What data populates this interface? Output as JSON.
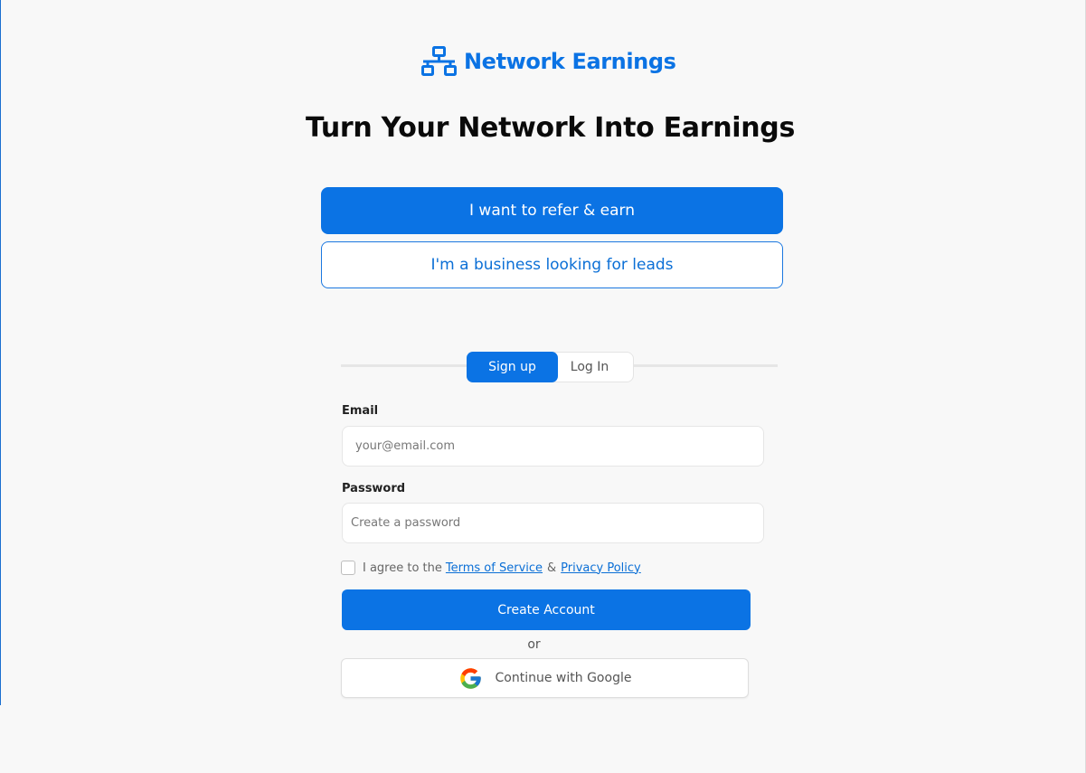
{
  "brand": {
    "name": "Network Earnings",
    "color": "#0b73e4"
  },
  "hero": {
    "headline": "Turn Your Network Into Earnings"
  },
  "roles": {
    "referrer_label": "I want to refer & earn",
    "business_label": "I'm a business looking for leads"
  },
  "tabs": {
    "signup_label": "Sign up",
    "login_label": "Log In",
    "active": "signup"
  },
  "form": {
    "email_label": "Email",
    "email_placeholder": "your@email.com",
    "email_value": "",
    "password_label": "Password",
    "password_placeholder": "Create a password",
    "password_value": "",
    "agree_prefix": "I agree to the",
    "terms_link": "Terms of Service",
    "amp": "&",
    "privacy_link": "Privacy Policy",
    "agree_checked": false,
    "submit_label": "Create Account",
    "or_text": "or",
    "google_label": "Continue with Google"
  },
  "icons": {
    "logo": "network-icon",
    "google": "google-icon"
  }
}
